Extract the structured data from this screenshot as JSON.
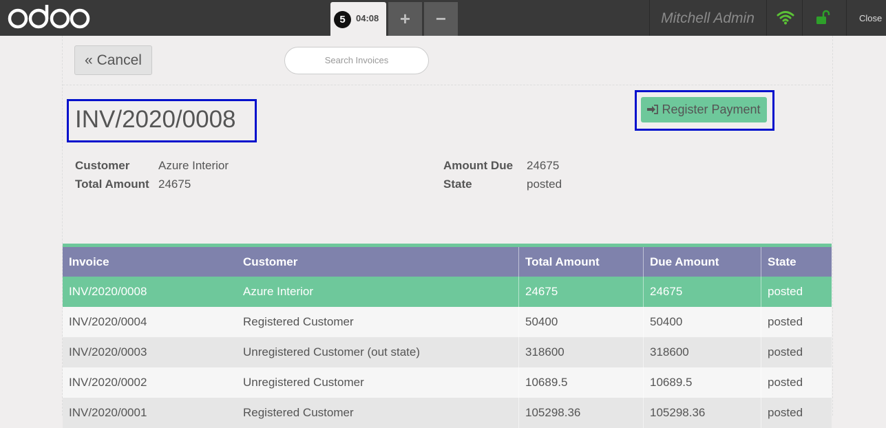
{
  "header": {
    "logo_text": "odoo",
    "order": {
      "number": "5",
      "time": "04:08"
    },
    "add_label": "+",
    "remove_label": "−",
    "user": "Mitchell Admin",
    "close_label": "Close",
    "colors": {
      "bar": "#393939",
      "wifi": "#5bc236",
      "lock": "#2ea02a"
    }
  },
  "toolbar": {
    "cancel_label": "Cancel",
    "search_placeholder": "Search Invoices"
  },
  "detail": {
    "title": "INV/2020/0008",
    "register_label": "Register Payment",
    "fields": {
      "customer_label": "Customer",
      "customer_value": "Azure Interior",
      "total_label": "Total Amount",
      "total_value": "24675",
      "due_label": "Amount Due",
      "due_value": "24675",
      "state_label": "State",
      "state_value": "posted"
    }
  },
  "table": {
    "columns": [
      "Invoice",
      "Customer",
      "Total Amount",
      "Due Amount",
      "State"
    ],
    "rows": [
      [
        "INV/2020/0008",
        "Azure Interior",
        "24675",
        "24675",
        "posted"
      ],
      [
        "INV/2020/0004",
        "Registered Customer",
        "50400",
        "50400",
        "posted"
      ],
      [
        "INV/2020/0003",
        "Unregistered Customer (out state)",
        "318600",
        "318600",
        "posted"
      ],
      [
        "INV/2020/0002",
        "Unregistered Customer",
        "10689.5",
        "10689.5",
        "posted"
      ],
      [
        "INV/2020/0001",
        "Registered Customer",
        "105298.36",
        "105298.36",
        "posted"
      ]
    ],
    "selected_row": 0,
    "colors": {
      "header": "#7f82ac",
      "selected": "#6ec89b"
    }
  }
}
